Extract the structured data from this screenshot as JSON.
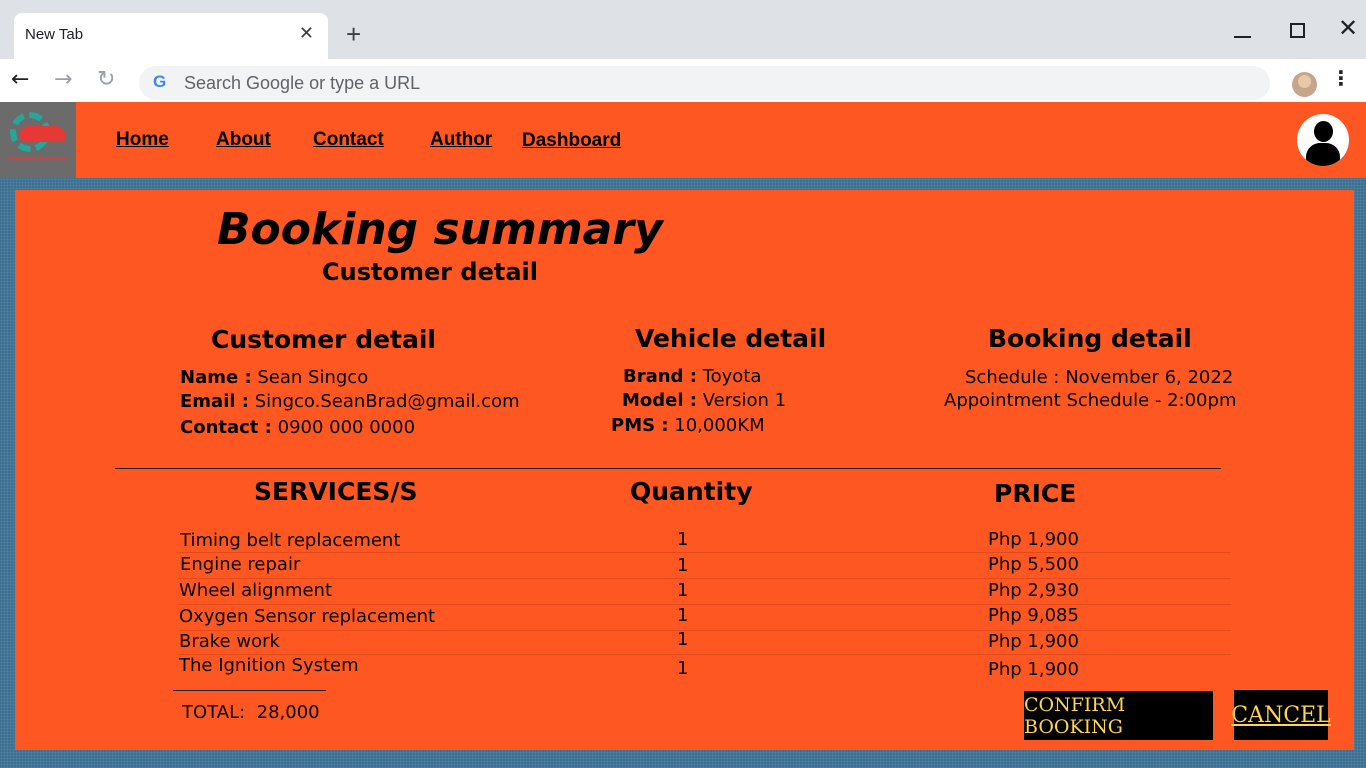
{
  "browser": {
    "tab_title": "New Tab",
    "tab_close": "✕",
    "new_tab": "+",
    "omnibox_placeholder": "Search Google or type a URL",
    "google_glyph": "G",
    "icons": [
      "back-arrow-icon",
      "forward-arrow-icon",
      "reload-icon",
      "google-icon",
      "profile-avatar",
      "more-options-icon",
      "minimize-icon",
      "maximize-icon",
      "close-window-icon"
    ]
  },
  "nav": {
    "links": [
      "Home",
      "About",
      "Contact",
      "Author",
      "Dashboard"
    ],
    "accent": "#ff5722"
  },
  "summary": {
    "title": "Booking summary",
    "subtitle": "Customer detail"
  },
  "customer": {
    "heading": "Customer detail",
    "name_label": "Name :",
    "name": "Sean Singco",
    "email_label": "Email :",
    "email": "Singco.SeanBrad@gmail.com",
    "contact_label": "Contact :",
    "contact": "0900 000 0000"
  },
  "vehicle": {
    "heading": "Vehicle detail",
    "brand_label": "Brand :",
    "brand": "Toyota",
    "model_label": "Model :",
    "model": "Version 1",
    "pms_label": "PMS :",
    "pms": "10,000KM"
  },
  "booking": {
    "heading": "Booking detail",
    "schedule": "Schedule : November 6, 2022",
    "appointment": "Appointment Schedule - 2:00pm"
  },
  "services": {
    "headers": [
      "SERVICES/S",
      "Quantity",
      "PRICE"
    ],
    "rows": [
      {
        "service": "Timing belt replacement",
        "qty": "1",
        "price": "Php 1,900"
      },
      {
        "service": "Engine repair",
        "qty": "1",
        "price": "Php 5,500"
      },
      {
        "service": "Wheel alignment",
        "qty": "1",
        "price": "Php 2,930"
      },
      {
        "service": "Oxygen Sensor replacement",
        "qty": "1",
        "price": "Php 9,085"
      },
      {
        "service": "Brake work",
        "qty": "1",
        "price": "Php 1,900"
      },
      {
        "service": "The Ignition System",
        "qty": "1",
        "price": "Php 1,900"
      }
    ],
    "total_label": "TOTAL:",
    "total_value": "28,000"
  },
  "actions": {
    "confirm": "CONFIRM BOOKING",
    "cancel": "CANCEL"
  }
}
